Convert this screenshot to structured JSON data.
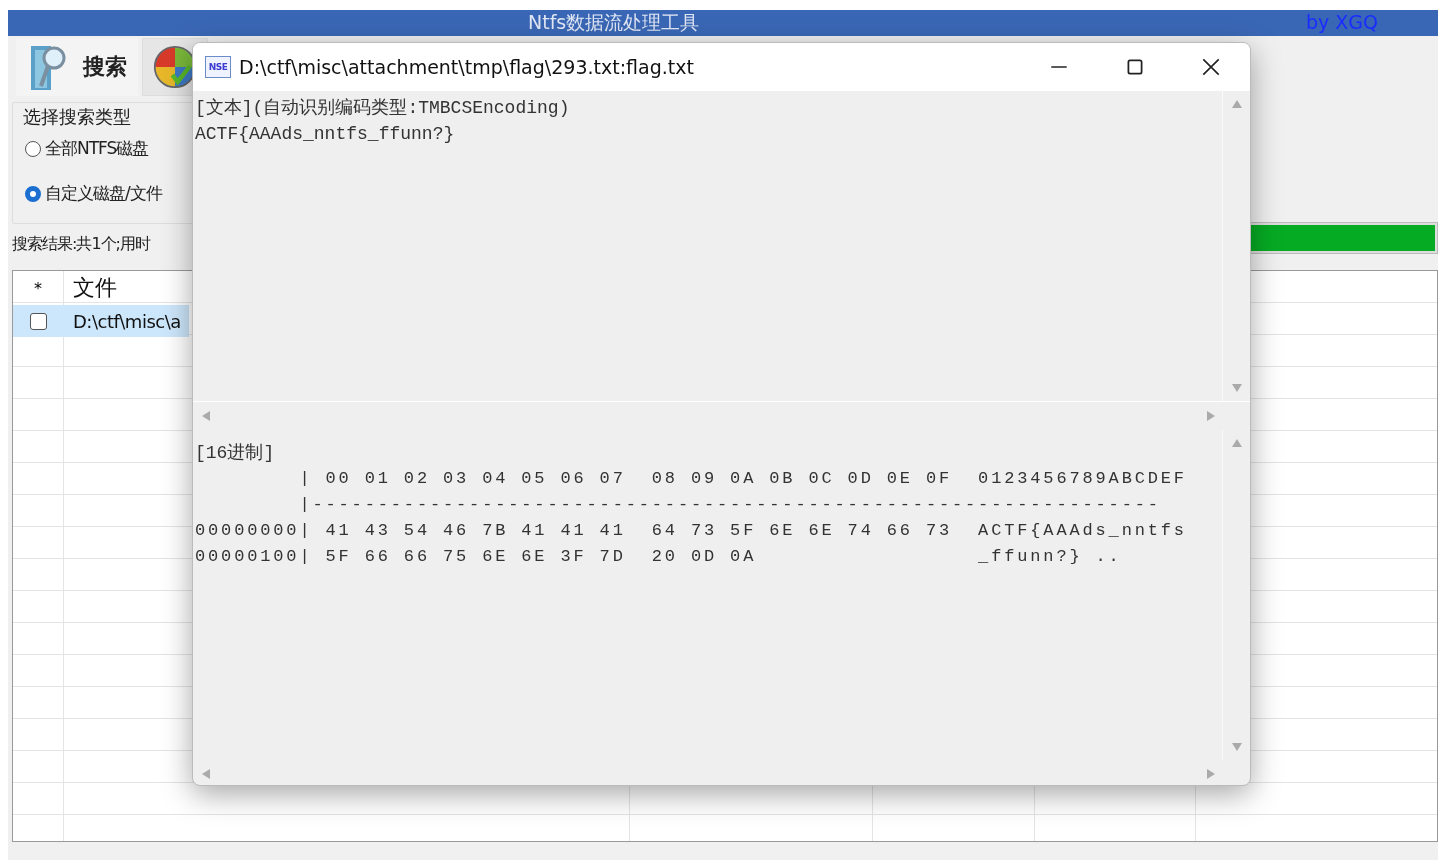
{
  "app": {
    "title": "Ntfs数据流处理工具",
    "author": "by XGQ",
    "tabs": [
      {
        "label": "搜索",
        "selected": true
      },
      {
        "selected": false
      }
    ],
    "search_type": {
      "legend": "选择搜索类型",
      "options": [
        {
          "label": "全部NTFS磁盘",
          "selected": false
        },
        {
          "label": "自定义磁盘/文件",
          "selected": true
        }
      ]
    },
    "result_summary": "搜索结果:共1个;用时",
    "progress": {
      "level": 1
    },
    "table": {
      "columns": [
        "*",
        "文件"
      ],
      "rows": [
        {
          "checked": false,
          "file": "D:\\ctf\\misc\\a",
          "selected": true
        }
      ]
    }
  },
  "dialog": {
    "icon_text": "NSE",
    "title": "D:\\ctf\\misc\\attachment\\tmp\\flag\\293.txt:flag.txt",
    "text_pane": {
      "lines": [
        "[文本](自动识别编码类型:TMBCSEncoding)",
        "ACTF{AAAds_nntfs_ffunn?}"
      ]
    },
    "hex_pane": {
      "label": "[16进制]",
      "lines": [
        "        | 00 01 02 03 04 05 06 07  08 09 0A 0B 0C 0D 0E 0F  0123456789ABCDEF",
        "        |-----------------------------------------------------------------",
        "00000000| 41 43 54 46 7B 41 41 41  64 73 5F 6E 6E 74 66 73  ACTF{AAAds_nntfs",
        "00000100| 5F 66 66 75 6E 6E 3F 7D  20 0D 0A                 _ffunn?} .."
      ]
    }
  }
}
